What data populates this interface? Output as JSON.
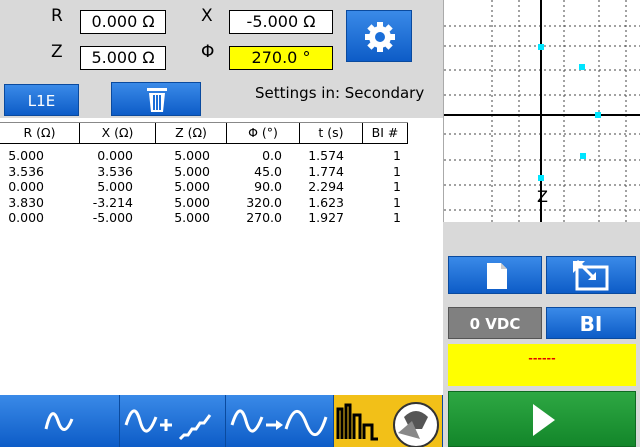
{
  "inputs": {
    "r_label": "R",
    "r_value": "0.000 Ω",
    "x_label": "X",
    "x_value": "-5.000 Ω",
    "z_label": "Z",
    "z_value": "5.000 Ω",
    "phi_label": "Φ",
    "phi_value": "270.0 °"
  },
  "buttons": {
    "l1e_label": "L1E",
    "settings_icon": "gear-icon",
    "delete_icon": "trash-icon"
  },
  "settings_text": "Settings in: Secondary",
  "table": {
    "headers": [
      "R (Ω)",
      "X (Ω)",
      "Z (Ω)",
      "Φ (°)",
      "t (s)",
      "BI #"
    ],
    "rows": [
      [
        "5.000",
        "0.000",
        "5.000",
        "0.0",
        "1.574",
        "1"
      ],
      [
        "3.536",
        "3.536",
        "5.000",
        "45.0",
        "1.774",
        "1"
      ],
      [
        "0.000",
        "5.000",
        "5.000",
        "90.0",
        "2.294",
        "1"
      ],
      [
        "3.830",
        "-3.214",
        "5.000",
        "320.0",
        "1.623",
        "1"
      ],
      [
        "0.000",
        "-5.000",
        "5.000",
        "270.0",
        "1.927",
        "1"
      ]
    ]
  },
  "plot": {
    "axis_label": "Z",
    "accent": "#00e5ff"
  },
  "right": {
    "voltage": "0 VDC",
    "bi_label": "BI",
    "status": "------",
    "doc_icon": "document-icon",
    "export_icon": "export-icon",
    "play_icon": "play-icon"
  },
  "bottom_tabs": [
    "sine-wave-icon",
    "sine-ramp-icon",
    "sine-transition-icon",
    "pulse-mode-icon"
  ],
  "colors": {
    "button_blue": "#1a6ed8",
    "highlight_yellow": "#ffff00",
    "play_green": "#1f9a36",
    "panel_gray": "#d9d9d9"
  }
}
